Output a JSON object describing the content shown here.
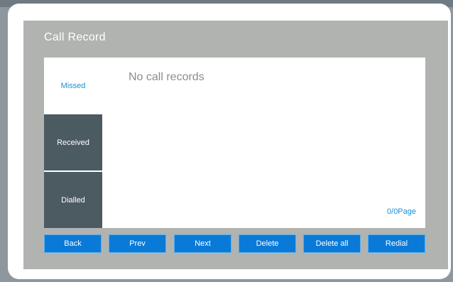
{
  "screen": {
    "title": "Call Record"
  },
  "tabs": [
    {
      "label": "Missed",
      "state": "active"
    },
    {
      "label": "Received",
      "state": "inactive"
    },
    {
      "label": "Dialled",
      "state": "inactive"
    }
  ],
  "content": {
    "empty_message": "No call records",
    "page_info": "0/0Page"
  },
  "buttons": [
    {
      "label": "Back"
    },
    {
      "label": "Prev"
    },
    {
      "label": "Next"
    },
    {
      "label": "Delete"
    },
    {
      "label": "Delete all"
    },
    {
      "label": "Redial"
    }
  ],
  "colors": {
    "accent": "#1a8fd6",
    "button": "#0a7ad8",
    "tab_inactive": "#4c5a62",
    "panel": "#b1b3b1"
  }
}
